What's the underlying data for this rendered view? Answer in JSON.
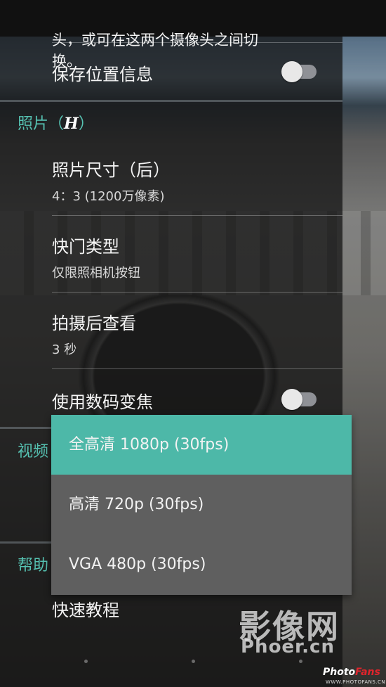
{
  "top_clipped_text": {
    "line1": "头，或可在这两个摄像头之间切",
    "line2": "换。"
  },
  "settings": {
    "save_location": {
      "label": "保存位置信息",
      "toggle_on": false
    },
    "section_photo": {
      "label": "照片（",
      "logo": "H",
      "label_end": "）"
    },
    "photo_size": {
      "title": "照片尺寸（后）",
      "value": "4：3 (1200万像素)"
    },
    "shutter_type": {
      "title": "快门类型",
      "value": "仅限照相机按钮"
    },
    "review": {
      "title": "拍摄后查看",
      "value": "3 秒"
    },
    "digital_zoom": {
      "label": "使用数码变焦",
      "toggle_on": false
    },
    "section_video": {
      "label": "视频"
    },
    "section_help": {
      "label": "帮助"
    },
    "quick_tutorial": {
      "title": "快速教程"
    }
  },
  "dropdown": {
    "options": [
      {
        "label": "全高清 1080p (30fps)",
        "selected": true
      },
      {
        "label": "高清 720p (30fps)",
        "selected": false
      },
      {
        "label": "VGA 480p (30fps)",
        "selected": false
      }
    ]
  },
  "watermark": {
    "chinese": "影像网",
    "url": "Phoer.cn",
    "brand_part1": "Photo",
    "brand_part2": "Fans",
    "brand_url": "WWW.PHOTOFANS.CN"
  },
  "colors": {
    "accent": "#56c2b2",
    "selected_option_bg": "#4db8a8",
    "dropdown_bg": "#5f5f5f"
  }
}
